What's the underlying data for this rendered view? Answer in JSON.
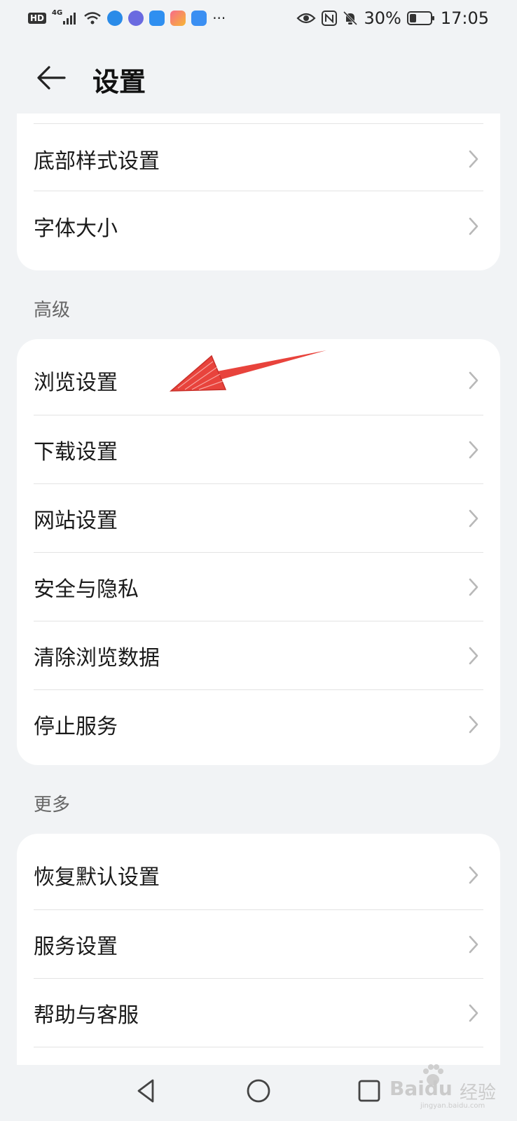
{
  "status_bar": {
    "hd": "HD",
    "network": "4G",
    "battery": "30%",
    "time": "17:05",
    "more": "···"
  },
  "header": {
    "title": "设置"
  },
  "top_section": {
    "items": [
      {
        "label": "底部样式设置"
      },
      {
        "label": "字体大小"
      }
    ]
  },
  "advanced_section": {
    "title": "高级",
    "items": [
      {
        "label": "浏览设置"
      },
      {
        "label": "下载设置"
      },
      {
        "label": "网站设置"
      },
      {
        "label": "安全与隐私"
      },
      {
        "label": "清除浏览数据"
      },
      {
        "label": "停止服务"
      }
    ]
  },
  "more_section": {
    "title": "更多",
    "items": [
      {
        "label": "恢复默认设置"
      },
      {
        "label": "服务设置"
      },
      {
        "label": "帮助与客服"
      }
    ]
  },
  "watermark": {
    "brand": "Baidu",
    "label": "经验",
    "url": "jingyan.baidu.com"
  },
  "colors": {
    "background": "#f1f3f5",
    "card": "#ffffff",
    "annotation_arrow": "#e8433c"
  }
}
